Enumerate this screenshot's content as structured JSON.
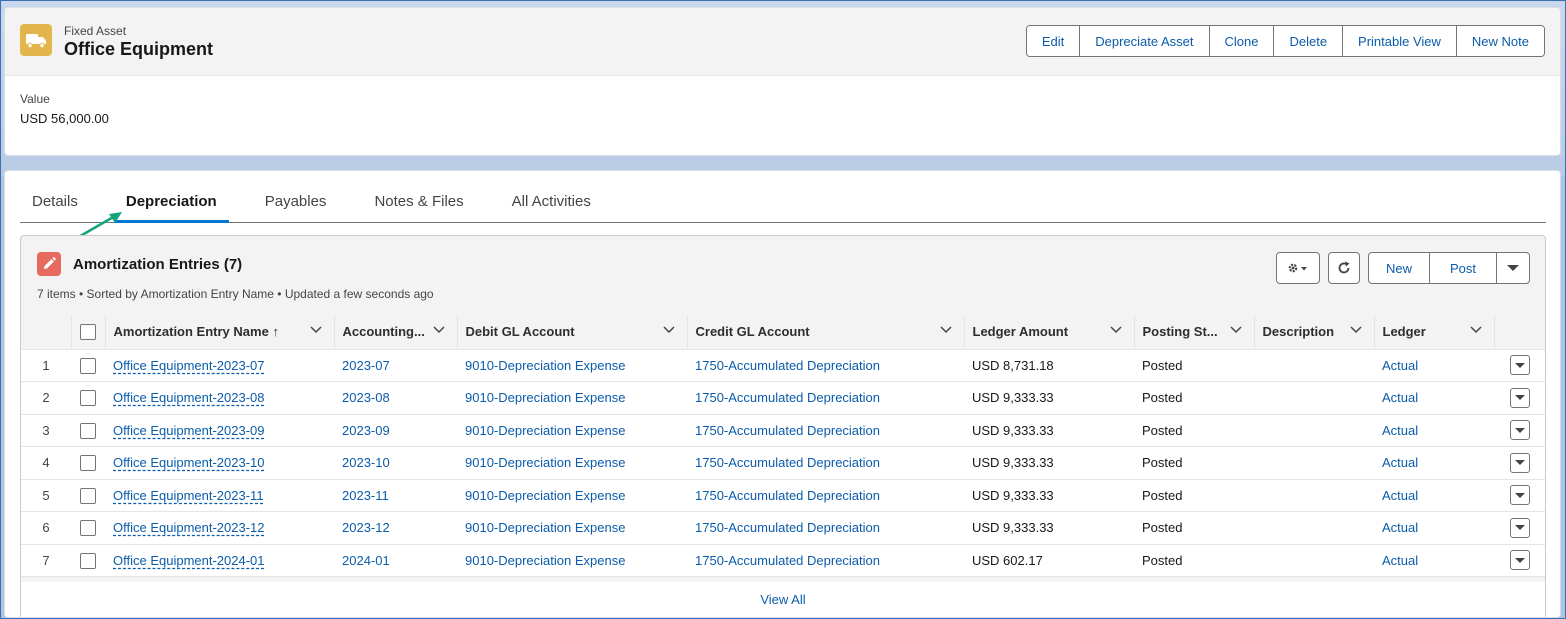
{
  "header": {
    "object_type": "Fixed Asset",
    "record_name": "Office Equipment",
    "buttons": [
      "Edit",
      "Depreciate Asset",
      "Clone",
      "Delete",
      "Printable View",
      "New Note"
    ],
    "value_label": "Value",
    "value": "USD 56,000.00"
  },
  "tabs": [
    "Details",
    "Depreciation",
    "Payables",
    "Notes & Files",
    "All Activities"
  ],
  "active_tab": "Depreciation",
  "related_list": {
    "title": "Amortization Entries (7)",
    "subtitle": "7 items • Sorted by Amortization Entry Name • Updated a few seconds ago",
    "buttons": {
      "new": "New",
      "post": "Post"
    },
    "columns": [
      "Amortization Entry Name",
      "Accounting...",
      "Debit GL Account",
      "Credit GL Account",
      "Ledger Amount",
      "Posting St...",
      "Description",
      "Ledger"
    ],
    "sort_indicator": "↑",
    "rows": [
      {
        "num": "1",
        "name": "Office Equipment-2023-07",
        "period": "2023-07",
        "debit": "9010-Depreciation Expense",
        "credit": "1750-Accumulated Depreciation",
        "amount": "USD 8,731.18",
        "status": "Posted",
        "description": "",
        "ledger": "Actual"
      },
      {
        "num": "2",
        "name": "Office Equipment-2023-08",
        "period": "2023-08",
        "debit": "9010-Depreciation Expense",
        "credit": "1750-Accumulated Depreciation",
        "amount": "USD 9,333.33",
        "status": "Posted",
        "description": "",
        "ledger": "Actual"
      },
      {
        "num": "3",
        "name": "Office Equipment-2023-09",
        "period": "2023-09",
        "debit": "9010-Depreciation Expense",
        "credit": "1750-Accumulated Depreciation",
        "amount": "USD 9,333.33",
        "status": "Posted",
        "description": "",
        "ledger": "Actual"
      },
      {
        "num": "4",
        "name": "Office Equipment-2023-10",
        "period": "2023-10",
        "debit": "9010-Depreciation Expense",
        "credit": "1750-Accumulated Depreciation",
        "amount": "USD 9,333.33",
        "status": "Posted",
        "description": "",
        "ledger": "Actual"
      },
      {
        "num": "5",
        "name": "Office Equipment-2023-11",
        "period": "2023-11",
        "debit": "9010-Depreciation Expense",
        "credit": "1750-Accumulated Depreciation",
        "amount": "USD 9,333.33",
        "status": "Posted",
        "description": "",
        "ledger": "Actual"
      },
      {
        "num": "6",
        "name": "Office Equipment-2023-12",
        "period": "2023-12",
        "debit": "9010-Depreciation Expense",
        "credit": "1750-Accumulated Depreciation",
        "amount": "USD 9,333.33",
        "status": "Posted",
        "description": "",
        "ledger": "Actual"
      },
      {
        "num": "7",
        "name": "Office Equipment-2024-01",
        "period": "2024-01",
        "debit": "9010-Depreciation Expense",
        "credit": "1750-Accumulated Depreciation",
        "amount": "USD 602.17",
        "status": "Posted",
        "description": "",
        "ledger": "Actual"
      }
    ],
    "view_all": "View All"
  },
  "colors": {
    "link": "#0b5cab",
    "object_icon": "#e3b54d",
    "list_icon": "#e66b5e",
    "active_tab": "#0176d3",
    "annotation_arrow": "#14a37f"
  },
  "icons": {
    "object": "truck-icon",
    "list": "pencil-icon",
    "settings": "gear-icon",
    "refresh": "refresh-icon",
    "menu": "chevron-down-icon"
  }
}
